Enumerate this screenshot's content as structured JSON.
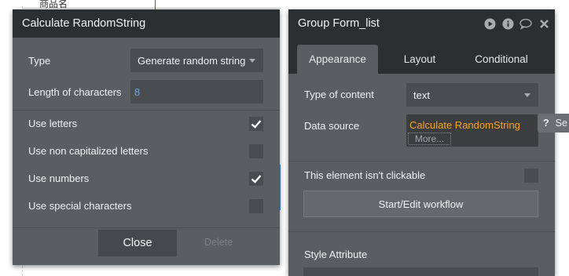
{
  "background": {
    "cell_text": "商品名"
  },
  "left_panel": {
    "title": "Calculate RandomString",
    "type_label": "Type",
    "type_value": "Generate random string",
    "length_label": "Length of characters",
    "length_value": "8",
    "options": [
      {
        "label": "Use letters",
        "checked": true
      },
      {
        "label": "Use non capitalized letters",
        "checked": false
      },
      {
        "label": "Use numbers",
        "checked": true
      },
      {
        "label": "Use special characters",
        "checked": false
      }
    ],
    "close_label": "Close",
    "delete_label": "Delete"
  },
  "right_panel": {
    "title": "Group Form_list",
    "header_icons": [
      "play-icon",
      "info-icon",
      "comment-icon",
      "close-icon"
    ],
    "tabs": [
      {
        "label": "Appearance",
        "active": true
      },
      {
        "label": "Layout",
        "active": false
      },
      {
        "label": "Conditional",
        "active": false
      }
    ],
    "type_of_content_label": "Type of content",
    "type_of_content_value": "text",
    "data_source_label": "Data source",
    "data_source_value": "Calculate RandomString",
    "more_label": "More...",
    "not_clickable_label": "This element isn't clickable",
    "not_clickable_checked": false,
    "workflow_button": "Start/Edit workflow",
    "style_attribute_label": "Style Attribute"
  },
  "help_tab": {
    "icon": "?",
    "label": "Se"
  },
  "colors": {
    "panel_bg": "#5b5e61",
    "header_bg": "#2c2f30",
    "input_bg": "#4a4d50",
    "accent_orange": "#f5a623",
    "accent_blue": "#6aa6e8"
  }
}
